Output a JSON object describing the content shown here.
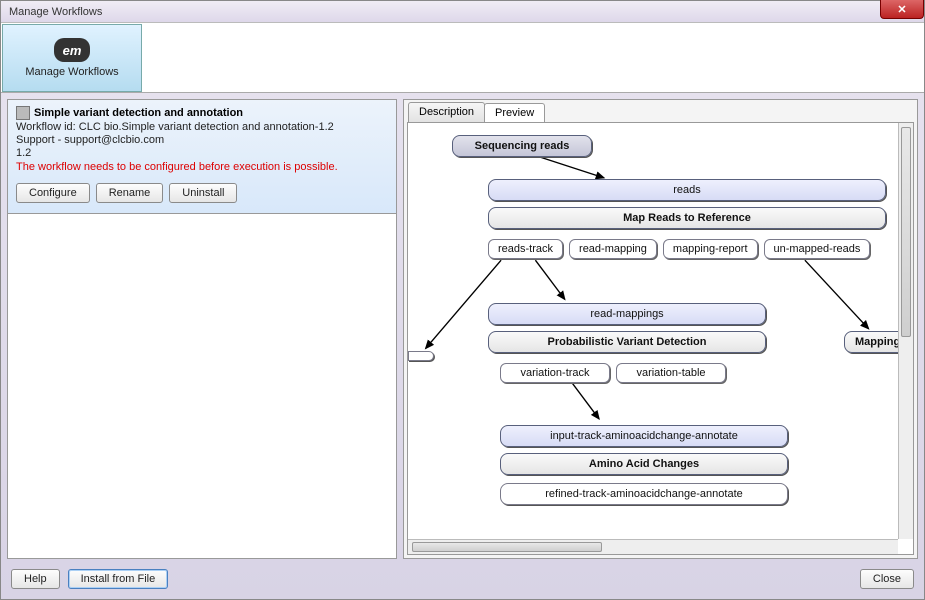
{
  "window": {
    "title": "Manage Workflows"
  },
  "toolbar": {
    "tool_label": "Manage Workflows",
    "tool_glyph": "em"
  },
  "workflow": {
    "title": "Simple variant detection and annotation",
    "id_line": "Workflow id: CLC bio.Simple variant detection and annotation-1.2",
    "support_line": "Support - support@clcbio.com",
    "version": "1.2",
    "warning": "The workflow needs to be configured before execution is possible.",
    "btn_configure": "Configure",
    "btn_rename": "Rename",
    "btn_uninstall": "Uninstall"
  },
  "tabs": {
    "description": "Description",
    "preview": "Preview"
  },
  "diagram": {
    "start": "Sequencing reads",
    "reads_in": "reads",
    "map_proc": "Map Reads to Reference",
    "map_out1": "reads-track",
    "map_out2": "read-mapping",
    "map_out3": "mapping-report",
    "map_out4": "un-mapped-reads",
    "rm_in": "read-mappings",
    "pvd_proc": "Probabilistic Variant Detection",
    "pvd_out1": "variation-track",
    "pvd_out2": "variation-table",
    "mapping_side": "Mapping",
    "aac_in": "input-track-aminoacidchange-annotate",
    "aac_proc": "Amino Acid Changes",
    "aac_out": "refined-track-aminoacidchange-annotate"
  },
  "footer": {
    "help": "Help",
    "install": "Install from File",
    "close": "Close"
  }
}
